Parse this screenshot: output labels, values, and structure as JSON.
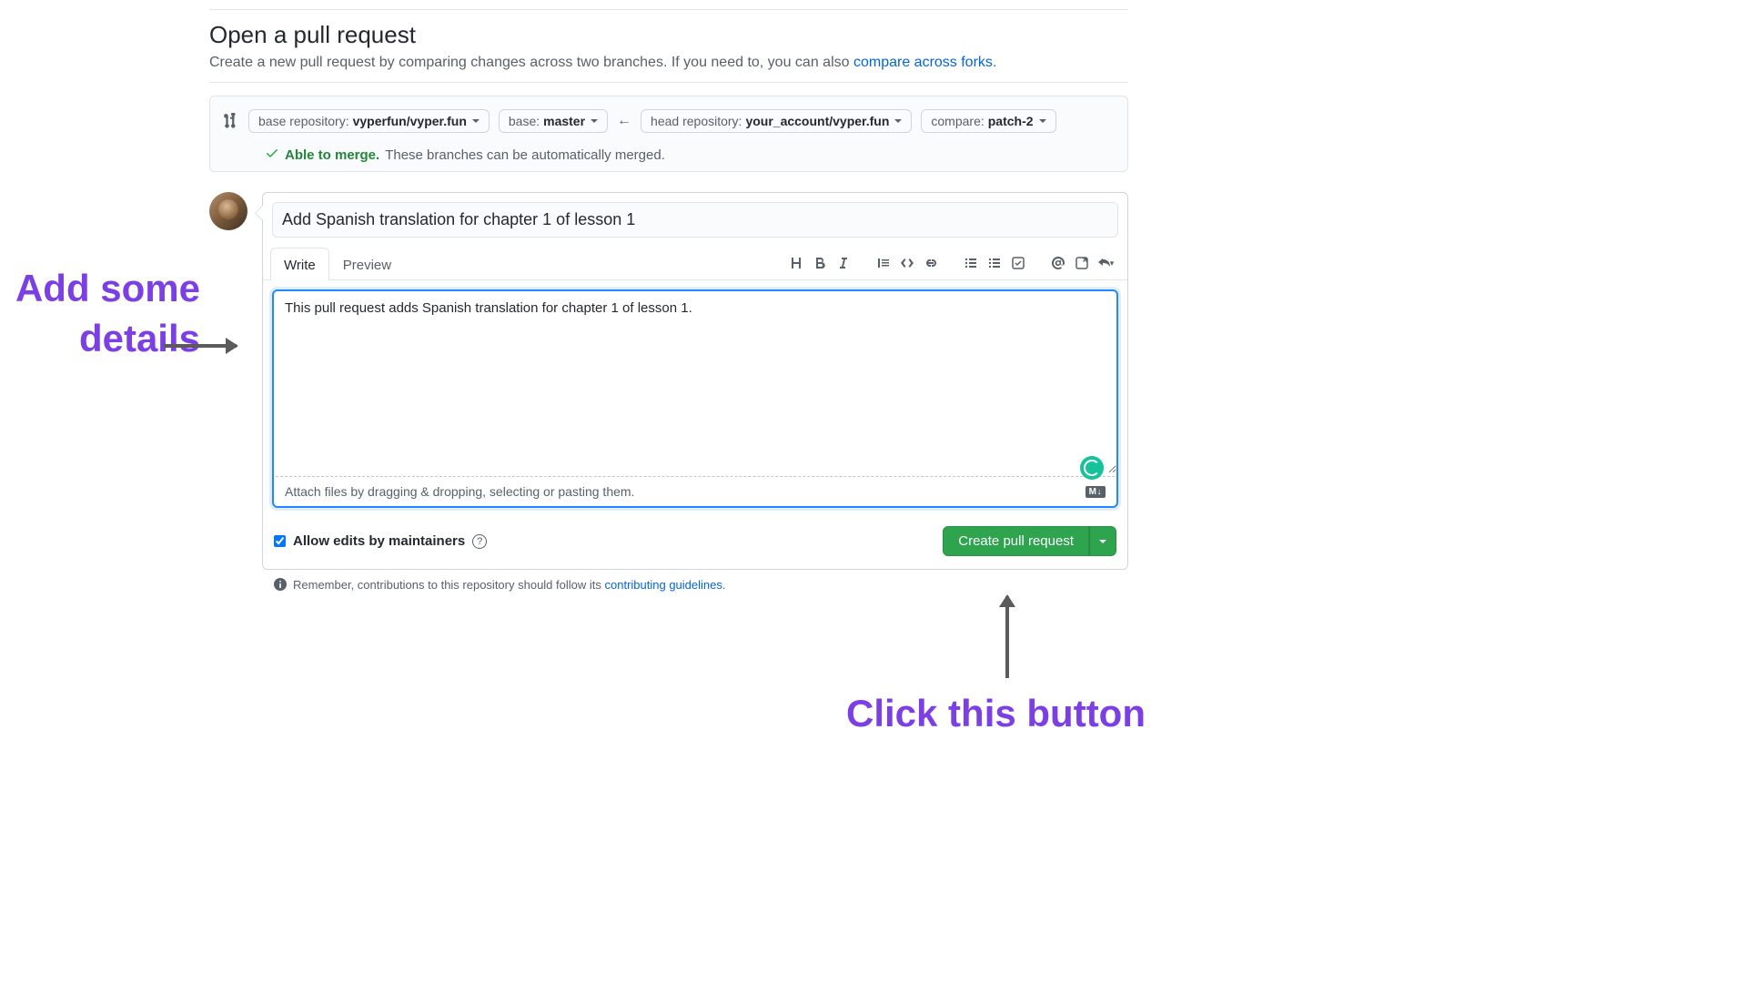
{
  "header": {
    "title": "Open a pull request",
    "subtitle_pre": "Create a new pull request by comparing changes across two branches. If you need to, you can also ",
    "subtitle_link": "compare across forks",
    "subtitle_post": "."
  },
  "compare": {
    "base_repo_label": "base repository: ",
    "base_repo_value": "vyperfun/vyper.fun",
    "base_branch_label": "base: ",
    "base_branch_value": "master",
    "head_repo_label": "head repository: ",
    "head_repo_value": "your_account/vyper.fun",
    "compare_label": "compare: ",
    "compare_value": "patch-2",
    "merge_able": "Able to merge.",
    "merge_msg": "These branches can be automatically merged."
  },
  "pr": {
    "title_value": "Add Spanish translation for chapter 1 of lesson 1",
    "tabs": {
      "write": "Write",
      "preview": "Preview"
    },
    "body_value": "This pull request adds Spanish translation for chapter 1 of lesson 1.",
    "attach_hint": "Attach files by dragging & dropping, selecting or pasting them.",
    "md_badge": "M↓"
  },
  "footer": {
    "allow_label": "Allow edits by maintainers",
    "create_label": "Create pull request",
    "remember_pre": "Remember, contributions to this repository should follow its ",
    "remember_link": "contributing guidelines",
    "remember_post": "."
  },
  "annotations": {
    "details": "Add some details",
    "click": "Click this button"
  }
}
